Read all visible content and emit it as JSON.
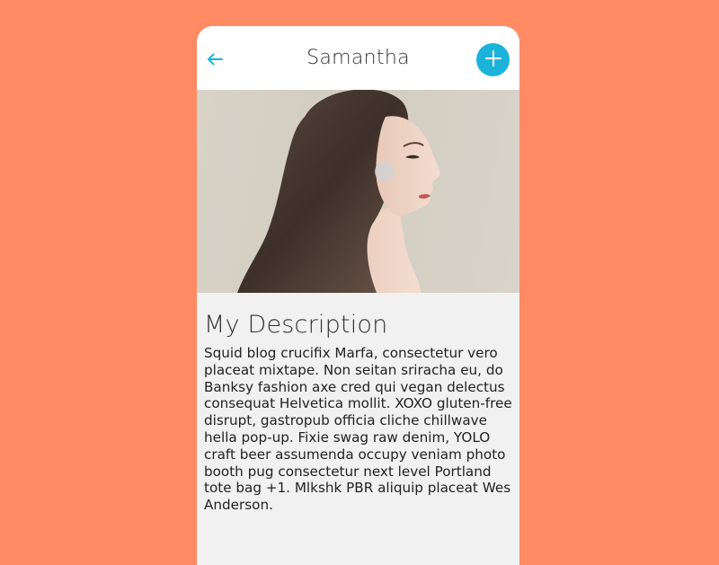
{
  "header": {
    "title": "Samantha",
    "back_icon": "arrow-left-icon",
    "add_icon": "plus-icon"
  },
  "colors": {
    "background": "#FF8A63",
    "accent": "#1BB3D9",
    "card": "#F1F1F1",
    "header": "#FFFFFF"
  },
  "photo": {
    "subject": "profile-photo"
  },
  "description": {
    "heading": "My Description",
    "body": "Squid blog crucifix Marfa, consectetur vero placeat mixtape. Non seitan sriracha eu, do Banksy fashion axe cred qui vegan delectus consequat Helvetica mollit. XOXO gluten-free disrupt, gastropub officia cliche chillwave hella pop-up. Fixie swag raw denim, YOLO craft beer assumenda occupy veniam photo booth pug consectetur next level Portland tote bag +1. Mlkshk PBR aliquip placeat Wes Anderson."
  }
}
